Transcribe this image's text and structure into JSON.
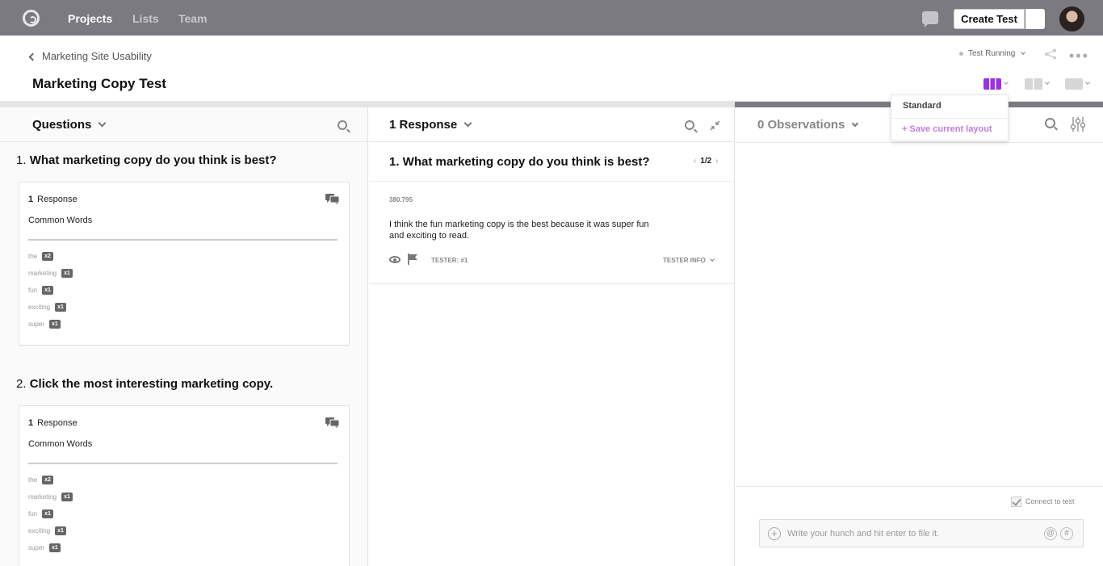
{
  "nav": {
    "items": [
      {
        "label": "Projects",
        "active": true
      },
      {
        "label": "Lists",
        "active": false
      },
      {
        "label": "Team",
        "active": false
      }
    ],
    "create_label": "Create Test"
  },
  "header": {
    "breadcrumb": "Marketing Site Usability",
    "title": "Marketing Copy Test",
    "status": "Test Running"
  },
  "layout_menu": {
    "option": "Standard",
    "save": "+ Save current layout",
    "accent": "#9b30e8"
  },
  "questions": {
    "heading": "Questions",
    "items": [
      {
        "number": "1.",
        "text": "What marketing copy do you think is best?",
        "response_count": "1",
        "response_label": "Response",
        "common_words_label": "Common Words",
        "words": [
          {
            "word": "the",
            "count": "x2"
          },
          {
            "word": "marketing",
            "count": "x1"
          },
          {
            "word": "fun",
            "count": "x1"
          },
          {
            "word": "exciting",
            "count": "x1"
          },
          {
            "word": "super",
            "count": "x1"
          }
        ]
      },
      {
        "number": "2.",
        "text": "Click the most interesting marketing copy.",
        "response_count": "1",
        "response_label": "Response",
        "common_words_label": "Common Words",
        "words": [
          {
            "word": "the",
            "count": "x2"
          },
          {
            "word": "marketing",
            "count": "x1"
          },
          {
            "word": "fun",
            "count": "x1"
          },
          {
            "word": "exciting",
            "count": "x1"
          },
          {
            "word": "super",
            "count": "x1"
          }
        ]
      }
    ]
  },
  "responses": {
    "heading": "1 Response",
    "question": "1. What marketing copy do you think is best?",
    "pager": "1/2",
    "time": "380.795",
    "text": "I think the fun marketing copy is the best because it was super fun and exciting to read.",
    "tester": "TESTER: #1",
    "tester_info": "TESTER INFO"
  },
  "observations": {
    "heading": "0 Observations",
    "connect_label": "Connect to test",
    "input_placeholder": "Write your hunch and hit enter to file it.",
    "input_value": ""
  }
}
